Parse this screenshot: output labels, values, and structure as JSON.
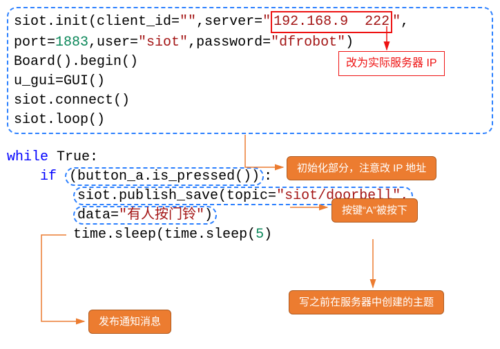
{
  "code": {
    "l1a": "siot.init(client_id=",
    "l1b": "\"\"",
    "l1c": ",server=",
    "l1d": "\"",
    "l1e": "192.168.9  222",
    "l1f": "\"",
    "l1g": ",",
    "l1g2": "",
    "l2a": "port=",
    "l2b": "1883",
    "l2c": ",user=",
    "l2d": "\"siot\"",
    "l2e": ",password=",
    "l2f": "\"dfrobot\"",
    "l2g": ")",
    "l3": "Board().begin()",
    "l4": "u_gui=GUI()",
    "l5": "siot.connect()",
    "l6": "siot.loop()",
    "l8a": "while",
    "l8b": " True:",
    "l9a": "    ",
    "l9b": "if",
    "l9c": " ",
    "l9d": "(button_a.is_pressed())",
    "l9e": ":",
    "l10a": "        ",
    "l10b": "siot.publish_save(topic=",
    "l10c": "\"siot/doorbell\",",
    "l11a": "        data=",
    "l11b": "\"有人按门铃\"",
    "l11c": ")",
    "l12a": "        time.sleep(",
    "l12b": "5",
    "l12c": ")"
  },
  "callouts": {
    "red": "改为实际服务器 IP",
    "init": "初始化部分，注意改 IP 地址",
    "button": "按键“A”被按下",
    "topic": "写之前在服务器中创建的主题",
    "publish": "发布通知消息"
  }
}
